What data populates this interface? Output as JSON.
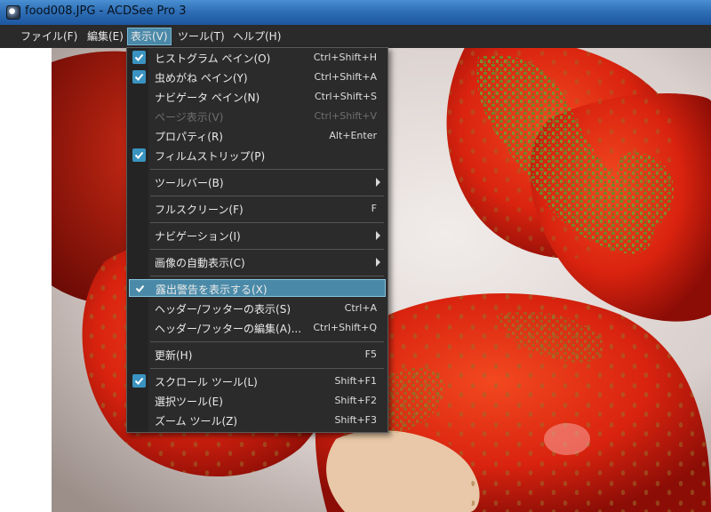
{
  "window": {
    "title": "food008.JPG - ACDSee Pro 3"
  },
  "menubar": [
    {
      "label": "ファイル(F)"
    },
    {
      "label": "編集(E)"
    },
    {
      "label": "表示(V)"
    },
    {
      "label": "ツール(T)"
    },
    {
      "label": "ヘルプ(H)"
    }
  ],
  "view_menu": {
    "items": [
      {
        "label": "ヒストグラム ペイン(O)",
        "shortcut": "Ctrl+Shift+H",
        "checked": true
      },
      {
        "label": "虫めがね ペイン(Y)",
        "shortcut": "Ctrl+Shift+A",
        "checked": true
      },
      {
        "label": "ナビゲータ ペイン(N)",
        "shortcut": "Ctrl+Shift+S"
      },
      {
        "label": "ページ表示(V)",
        "shortcut": "Ctrl+Shift+V",
        "disabled": true
      },
      {
        "label": "プロパティ(R)",
        "shortcut": "Alt+Enter"
      },
      {
        "label": "フィルムストリップ(P)",
        "shortcut": "",
        "checked": true
      },
      {
        "label": "ツールバー(B)",
        "submenu": true
      },
      {
        "label": "フルスクリーン(F)",
        "shortcut": "F"
      },
      {
        "label": "ナビゲーション(I)",
        "submenu": true
      },
      {
        "label": "画像の自動表示(C)",
        "submenu": true
      },
      {
        "label": "露出警告を表示する(X)",
        "checked": true,
        "highlighted": true
      },
      {
        "label": "ヘッダー/フッターの表示(S)",
        "shortcut": "Ctrl+A"
      },
      {
        "label": "ヘッダー/フッターの編集(A)...",
        "shortcut": "Ctrl+Shift+Q"
      },
      {
        "label": "更新(H)",
        "shortcut": "F5"
      },
      {
        "label": "スクロール ツール(L)",
        "shortcut": "Shift+F1",
        "checked": true
      },
      {
        "label": "選択ツール(E)",
        "shortcut": "Shift+F2"
      },
      {
        "label": "ズーム ツール(Z)",
        "shortcut": "Shift+F3"
      }
    ]
  },
  "colors": {
    "menu_bg": "#2b2b2b",
    "highlight": "#4a8aa8",
    "check": "#3a93c0",
    "exposure_warning": "#6b8a2a"
  }
}
